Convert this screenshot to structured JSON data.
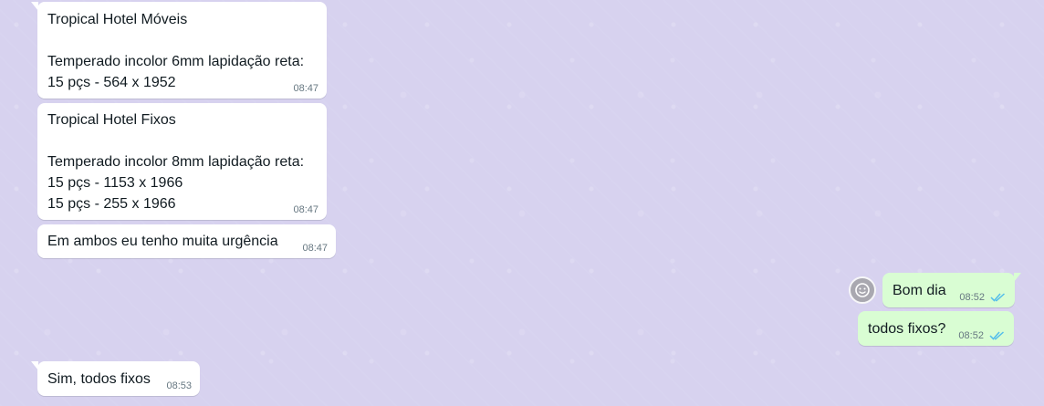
{
  "chat": {
    "messages": [
      {
        "direction": "in",
        "text": "Tropical Hotel Móveis\n\nTemperado incolor 6mm lapidação reta:\n15 pçs - 564 x 1952",
        "time": "08:47"
      },
      {
        "direction": "in",
        "text": "Tropical Hotel Fixos\n\nTemperado incolor 8mm lapidação reta:\n15 pçs - 1153 x 1966\n15 pçs - 255 x 1966",
        "time": "08:47"
      },
      {
        "direction": "in",
        "text": "Em ambos eu tenho muita urgência",
        "time": "08:47"
      },
      {
        "direction": "out",
        "text": "Bom dia",
        "time": "08:52",
        "status_icon": "double-check-read-icon"
      },
      {
        "direction": "out",
        "text": "todos fixos?",
        "time": "08:52",
        "status_icon": "double-check-read-icon"
      },
      {
        "direction": "in",
        "text": "Sim, todos fixos",
        "time": "08:53"
      }
    ]
  },
  "colors": {
    "wallpaper": "#d7d2ef",
    "incoming_bubble": "#ffffff",
    "outgoing_bubble": "#d9fdd3",
    "read_ticks": "#53bdeb",
    "time_text": "#667781"
  },
  "icons": {
    "avatar": "default-avatar-icon"
  }
}
